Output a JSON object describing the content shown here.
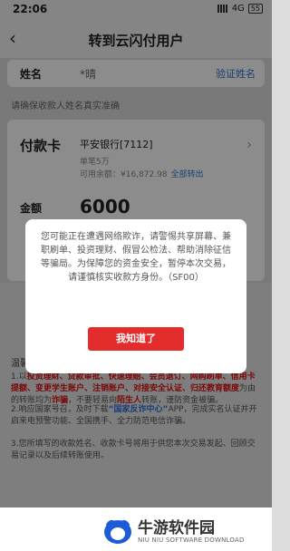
{
  "status": {
    "time": "22:06",
    "network": "4G",
    "battery": "55"
  },
  "nav": {
    "back_icon": "‹",
    "title": "转到云闪付用户"
  },
  "name_row": {
    "label": "姓名",
    "value": "*晴",
    "verify_label": "验证姓名"
  },
  "hint": "请确保收款人姓名真实准确",
  "payment": {
    "label": "付款卡",
    "bank": "平安银行[7112]",
    "limit": "单笔5万",
    "balance": "可用余额：¥16,872.98",
    "transfer_all": "全部转出",
    "amount_label": "金额",
    "amount": "6000"
  },
  "tips": {
    "title": "温馨提示",
    "line1_a": "1.以",
    "line1_b": "投资理财、贷款审批、快速理赔、会员退订、网购刷单、信用卡提额、变更学生账户、注销账户、对接安全认证、归还教育额度",
    "line1_c": "为由的转账均为",
    "line1_d": "诈骗",
    "line1_e": "，不要轻易向",
    "line1_f": "陌生人",
    "line1_g": "转账，谨防资金被骗。",
    "line2_a": "2.响应国家号召，及时下载",
    "line2_b": "“国家反诈中心”",
    "line2_c": "APP，完成实名认证并开启来电预警功能、全国携手、全力防范电信诈骗。",
    "line3": "3.您所填写的收款姓名、收款卡号将用于供您本次交易发起、回顾交易记录以及后续转账使用。"
  },
  "modal": {
    "message": "您可能正在遭遇网络欺诈，请警惕共享屏幕、兼职刷单、投资理财、假冒公检法、帮助消除征信等骗局。为保障您的资金安全，暂停本次交易，请谨慎核实收款方身份。（SF00）",
    "button": "我知道了"
  },
  "footer": {
    "brand": "牛游软件园",
    "sub": "NIU NIU SOFTWARE DOWNLOAD"
  },
  "colors": {
    "accent_blue": "#2a72d6",
    "danger_red": "#e32d2d"
  }
}
